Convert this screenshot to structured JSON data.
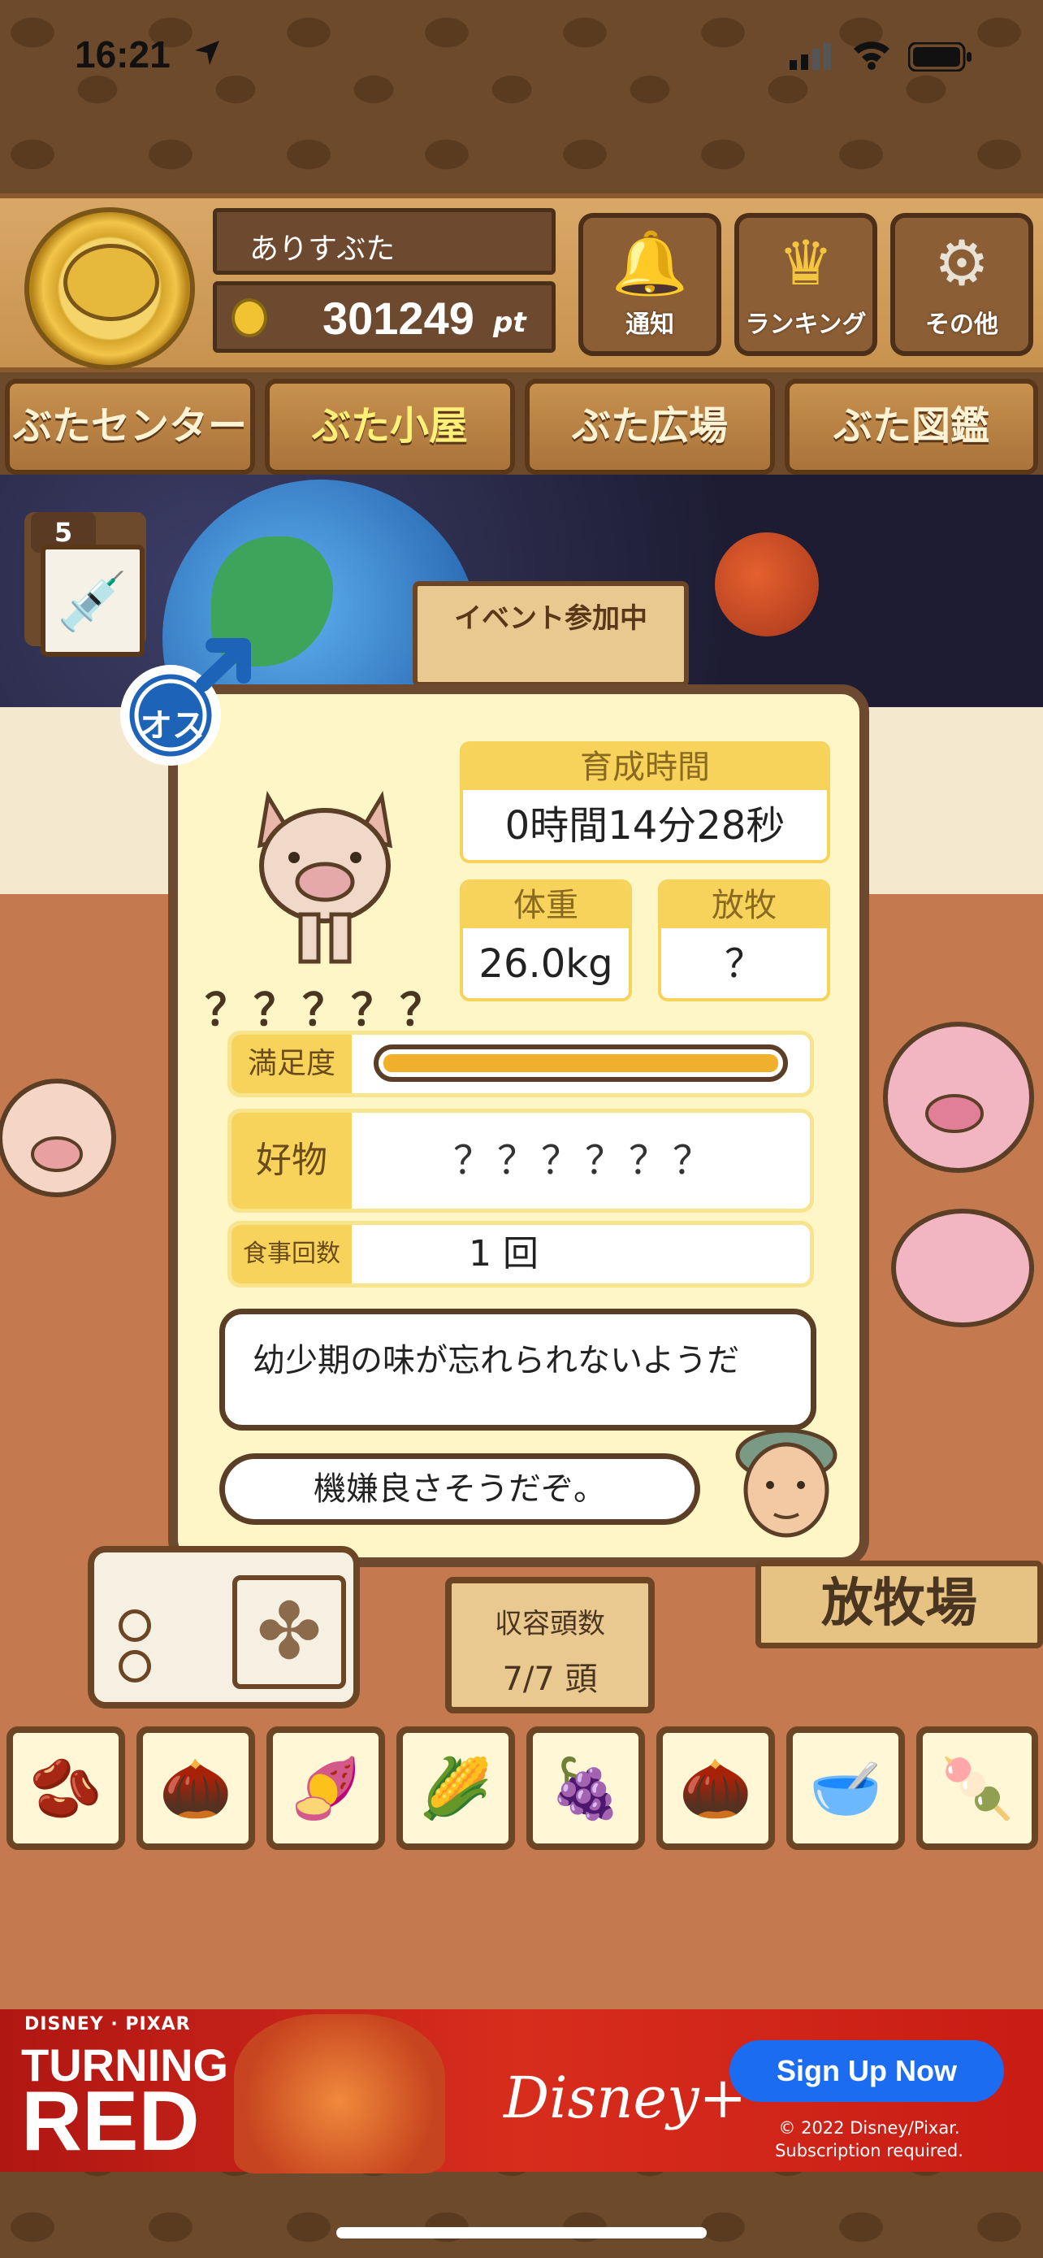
{
  "status_bar": {
    "time": "16:21"
  },
  "header": {
    "player_name": "ありすぶた",
    "points": "301249",
    "points_unit": "pt",
    "buttons": [
      {
        "label": "通知",
        "icon": "bell-icon"
      },
      {
        "label": "ランキング",
        "icon": "crown-icon"
      },
      {
        "label": "その他",
        "icon": "gear-icon"
      }
    ]
  },
  "nav": {
    "tabs": [
      "ぶたセンター",
      "ぶた小屋",
      "ぶた広場",
      "ぶた図鑑"
    ],
    "active": "ぶた小屋"
  },
  "scene": {
    "injection_count": "5",
    "event_sign": "イベント参加中",
    "capacity_label": "収容頭数",
    "capacity_value": "7/7 頭",
    "ranch_label": "放牧場"
  },
  "pig_info": {
    "gender_label": "オス",
    "name": "？？？？？",
    "growth_time_label": "育成時間",
    "growth_time": "0時間14分28秒",
    "weight_label": "体重",
    "weight": "26.0kg",
    "grazing_label": "放牧",
    "grazing": "？",
    "satisfaction_label": "満足度",
    "satisfaction": 1.0,
    "favorite_label": "好物",
    "favorite": "？？？？？？",
    "meals_label": "食事回数",
    "meals": "1 回",
    "comment": "幼少期の味が忘れられないようだ",
    "mood": "機嫌良さそうだぞ。"
  },
  "food_items": [
    "mixed-grain-icon",
    "mixed-beans-icon",
    "sweet-potato-icon",
    "corn-icon",
    "berries-icon",
    "acorns-icon",
    "soybeans-icon",
    "meatballs-icon"
  ],
  "ad": {
    "brand": "DISNEY · PIXAR",
    "title_line1": "TURNING",
    "title_line2": "RED",
    "service": "Disney+",
    "cta": "Sign Up Now",
    "copyright": "© 2022 Disney/Pixar.",
    "note": "Subscription required."
  }
}
